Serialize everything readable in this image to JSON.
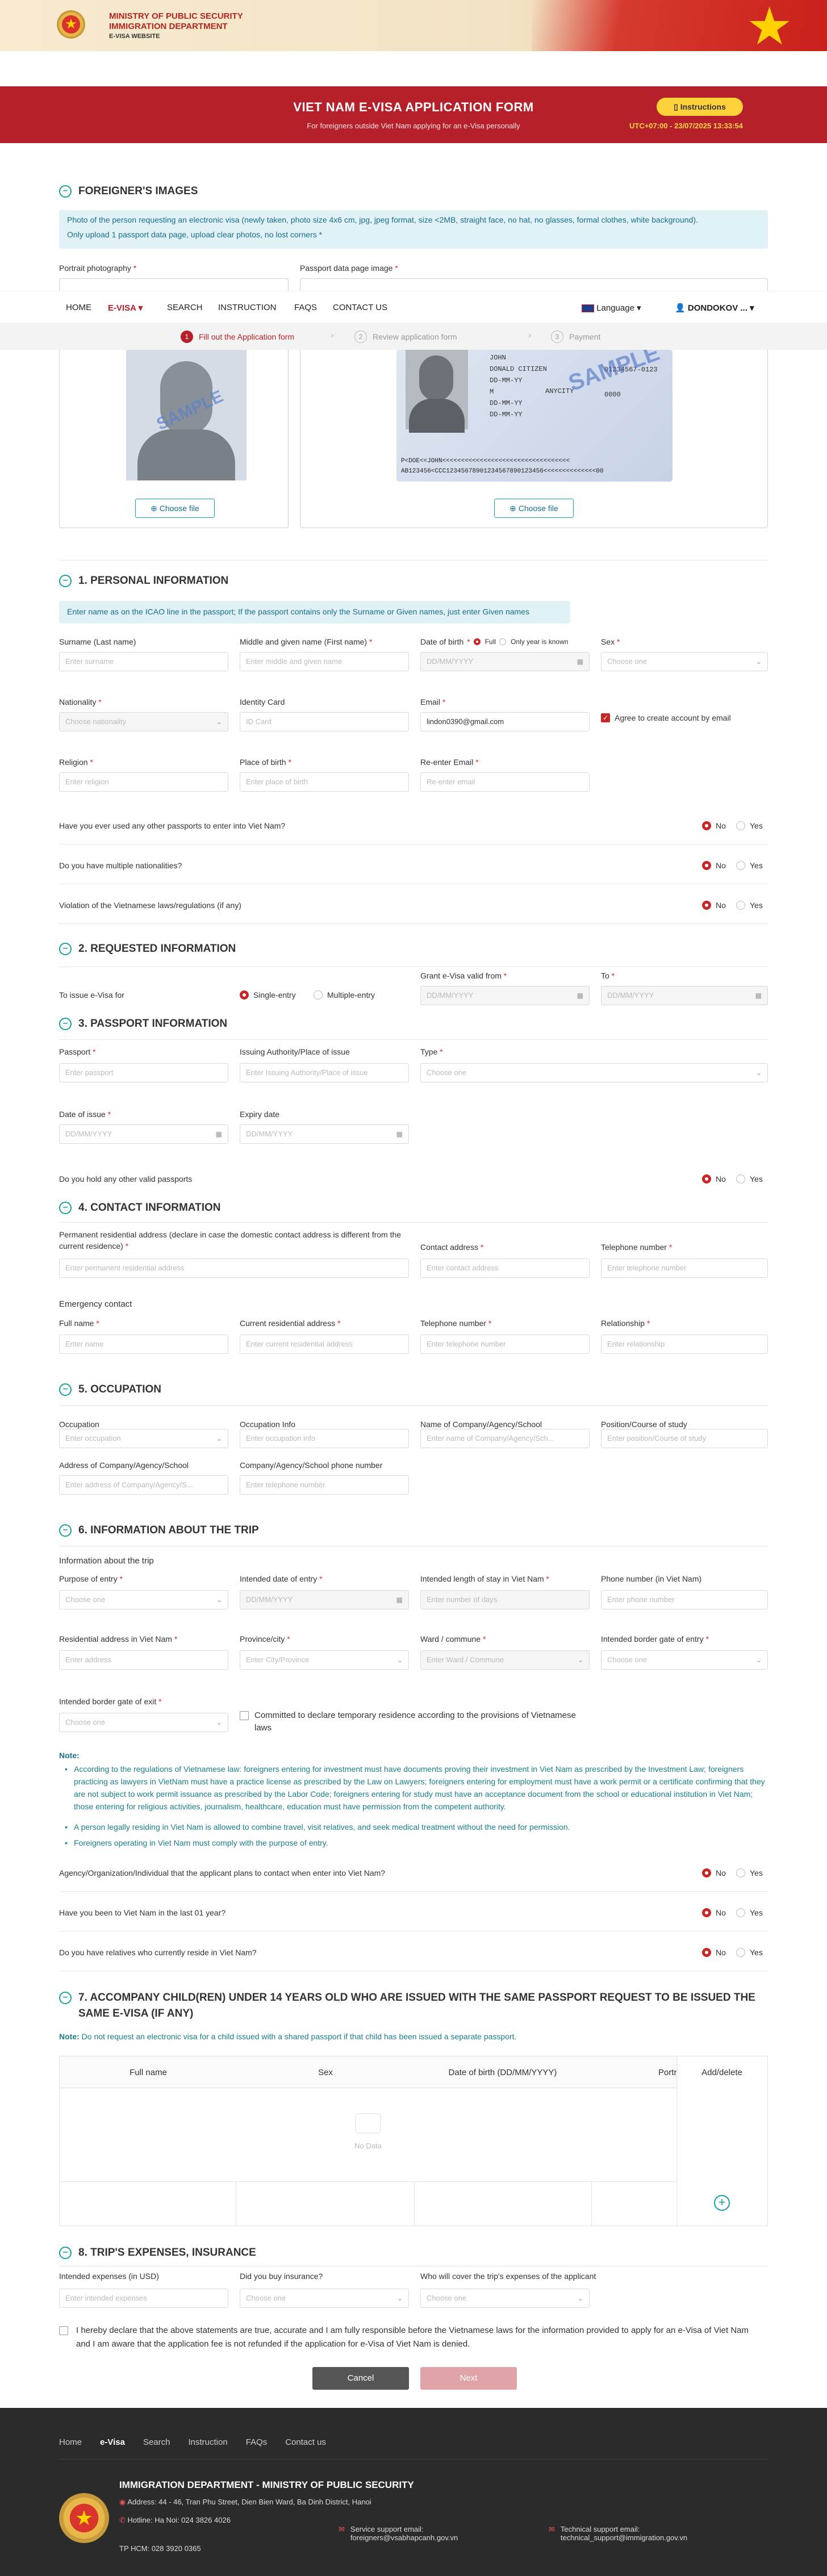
{
  "header": {
    "ministry": "MINISTRY OF PUBLIC SECURITY",
    "department": "IMMIGRATION DEPARTMENT",
    "site": "E-VISA WEBSITE"
  },
  "banner": {
    "title": "VIET NAM E-VISA APPLICATION FORM",
    "subtitle": "For foreigners outside Viet Nam applying for an e-Visa personally",
    "instructions": "Instructions",
    "clock": "UTC+07:00 - 23/07/2025 13:33:54"
  },
  "nav": {
    "items": [
      "HOME",
      "E-VISA",
      "SEARCH",
      "INSTRUCTION",
      "FAQS",
      "CONTACT US"
    ],
    "language": "Language",
    "user": "DONDOKOV ..."
  },
  "steps": [
    "Fill out the Application form",
    "Review application form",
    "Payment"
  ],
  "images": {
    "title": "FOREIGNER'S IMAGES",
    "info1": "Photo of the person requesting an electronic visa (newly taken, photo size 4x6 cm, jpg, jpeg format, size <2MB, straight face, no hat, no glasses, formal clothes, white background).",
    "info2": "Only upload 1 passport data page, upload clear photos, no lost corners *",
    "portrait": "Portrait photography",
    "passport": "Passport data page image",
    "choose": "Choose file",
    "sample": "SAMPLE"
  },
  "passport_sample": {
    "l1": "JOHN",
    "l2": "DONALD CITIZEN",
    "l3": "01234567-0123",
    "l4": "DD-MM-YY",
    "l5": "ANYCITY",
    "l6": "0000",
    "l7": "M",
    "l8": "DD-MM-YY",
    "l9": "DD-MM-YY",
    "mrz1": "P<DOE<<JOHN<<<<<<<<<<<<<<<<<<<<<<<<<<<<<<<<<<",
    "mrz2": "AB123456<CCC12345678901234567890123456<<<<<<<<<<<<<<00"
  },
  "personal": {
    "title": "1. PERSONAL INFORMATION",
    "info": "Enter name as on the ICAO line in the passport; If the passport contains only the Surname or Given names, just enter Given names",
    "surname": "Surname (Last name)",
    "surname_ph": "Enter surname",
    "given": "Middle and given name (First name)",
    "given_ph": "Enter middle and given name",
    "dob": "Date of birth",
    "full": "Full",
    "year_only": "Only year is known",
    "dob_ph": "DD/MM/YYYY",
    "sex": "Sex",
    "sex_ph": "Choose one",
    "nationality": "Nationality",
    "nationality_ph": "Choose nationality",
    "id_card": "Identity Card",
    "id_ph": "ID Card",
    "email": "Email",
    "email_val": "lindon0390@gmail.com",
    "agree": "Agree to create account by email",
    "religion": "Religion",
    "religion_ph": "Enter religion",
    "pob": "Place of birth",
    "pob_ph": "Enter place of birth",
    "reemail": "Re-enter Email",
    "reemail_ph": "Re-enter email",
    "q1": "Have you ever used any other passports to enter into Viet Nam?",
    "q2": "Do you have multiple nationalities?",
    "q3": "Violation of the Vietnamese laws/regulations (if any)",
    "no": "No",
    "yes": "Yes"
  },
  "requested": {
    "title": "2. REQUESTED INFORMATION",
    "to_issue": "To issue e-Visa for",
    "single": "Single-entry",
    "multiple": "Multiple-entry",
    "from": "Grant e-Visa valid from",
    "to": "To",
    "date_ph": "DD/MM/YYYY"
  },
  "passport": {
    "title": "3. PASSPORT INFORMATION",
    "passport": "Passport",
    "passport_ph": "Enter passport",
    "authority": "Issuing Authority/Place of issue",
    "authority_ph": "Enter Issuing Authority/Place of issue",
    "type": "Type",
    "type_ph": "Choose one",
    "doi": "Date of issue",
    "expiry": "Expiry date",
    "q": "Do you hold any other valid passports"
  },
  "contact": {
    "title": "4. CONTACT INFORMATION",
    "perm": "Permanent residential address (declare in case the domestic contact address is different from the current residence)",
    "perm_ph": "Enter permanent residential address",
    "addr": "Contact address",
    "addr_ph": "Enter contact address",
    "tel": "Telephone number",
    "tel_ph": "Enter telephone number",
    "emergency": "Emergency contact",
    "fullname": "Full name",
    "name_ph": "Enter name",
    "curr": "Current residential address",
    "curr_ph": "Enter current residential address",
    "rel": "Relationship",
    "rel_ph": "Enter relationship"
  },
  "occupation": {
    "title": "5. OCCUPATION",
    "occ": "Occupation",
    "occ_ph": "Enter occupation",
    "info": "Occupation Info",
    "info_ph": "Enter occupation info",
    "company": "Name of Company/Agency/School",
    "company_ph": "Enter name of Company/Agency/Sch...",
    "position": "Position/Course of study",
    "position_ph": "Enter position/Course of study",
    "caddr": "Address of Company/Agency/School",
    "caddr_ph": "Enter address of Company/Agency/S...",
    "cphone": "Company/Agency/School phone number",
    "cphone_ph": "Enter telephone number"
  },
  "trip": {
    "title": "6. INFORMATION ABOUT THE TRIP",
    "sub": "Information about the trip",
    "purpose": "Purpose of entry",
    "choose": "Choose one",
    "intended": "Intended date of entry",
    "length": "Intended length of stay in Viet Nam",
    "length_ph": "Enter number of days",
    "phone": "Phone number (in Viet Nam)",
    "phone_ph": "Enter phone number",
    "res": "Residential address in Viet Nam",
    "res_ph": "Enter address",
    "prov": "Province/city",
    "prov_ph": "Enter City/Province",
    "ward": "Ward / commune",
    "ward_ph": "Enter Ward / Commune",
    "border": "Intended border gate of entry",
    "exit": "Intended border gate of exit",
    "commit": "Committed to declare temporary residence according to the provisions of Vietnamese laws",
    "note": "Note:",
    "n1": "According to the regulations of Vietnamese law: foreigners entering for investment must have documents proving their investment in Viet Nam as prescribed by the Investment Law; foreigners practicing as lawyers in VietNam must have a practice license as prescribed by the Law on Lawyers; foreigners entering for employment must have a work permit or a certificate confirming that they are not subject to work permit issuance as prescribed by the Labor Code; foreigners entering for study must have an acceptance document from the school or educational institution in Viet Nam; those entering for religious activities, journalism, healthcare, education must have permission from the competent authority.",
    "n2": "A person legally residing in Viet Nam is allowed to combine travel, visit relatives, and seek medical treatment without the need for permission.",
    "n3": "Foreigners operating in Viet Nam must comply with the purpose of entry.",
    "q1": "Agency/Organization/Individual that the applicant plans to contact when enter into Viet Nam?",
    "q2": "Have you been to Viet Nam in the last 01 year?",
    "q3": "Do you have relatives who currently reside in Viet Nam?"
  },
  "children": {
    "title": "7. ACCOMPANY CHILD(REN) UNDER 14 YEARS OLD WHO ARE ISSUED WITH THE SAME PASSPORT REQUEST TO BE ISSUED THE SAME E-VISA (IF ANY)",
    "note_b": "Note:",
    "note": " Do not request an electronic visa for a child issued with a shared passport if that child has been issued a separate passport.",
    "cols": [
      "Full name",
      "Sex",
      "Date of birth (DD/MM/YYYY)",
      "Portr",
      "Add/delete"
    ],
    "nodata": "No Data"
  },
  "expenses": {
    "title": "8. TRIP'S EXPENSES, INSURANCE",
    "exp": "Intended expenses (in USD)",
    "exp_ph": "Enter intended expenses",
    "ins": "Did you buy insurance?",
    "who": "Who will cover the trip's expenses of the applicant",
    "choose": "Choose one"
  },
  "declare": "I hereby declare that the above statements are true, accurate and I am fully responsible before the Vietnamese laws for the information provided to apply for an e-Visa of Viet Nam and I am aware that the application fee is not refunded if the application for e-Visa of Viet Nam is denied.",
  "actions": {
    "cancel": "Cancel",
    "next": "Next"
  },
  "footer": {
    "links": [
      "Home",
      "e-Visa",
      "Search",
      "Instruction",
      "FAQs",
      "Contact us"
    ],
    "dept": "IMMIGRATION DEPARTMENT - MINISTRY OF PUBLIC SECURITY",
    "address": "Address: 44 - 46, Tran Phu Street, Dien Bien Ward, Ba Dinh District, Hanoi",
    "hotline": "Hotline: Ha Noi: 024 3826 4026",
    "hcm": "TP HCM: 028 3920 0365",
    "service": "Service support email:",
    "service_email": "foreigners@vsabhapcanh.gov.vn",
    "tech": "Technical support email:",
    "tech_email": "technical_support@immigration.gov.vn"
  },
  "colors": {
    "brand": "#b6202a",
    "accent": "#1a9fa3",
    "footer": "#2b2b2b"
  }
}
